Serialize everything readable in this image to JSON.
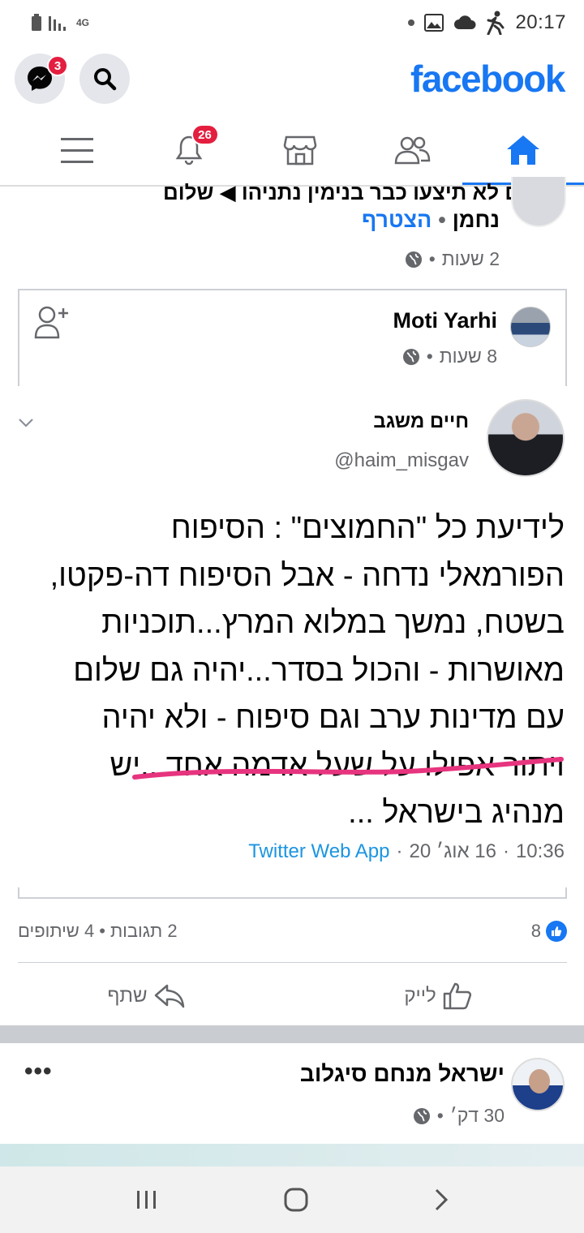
{
  "statusbar": {
    "network": "4G",
    "time": "20:17"
  },
  "header": {
    "logo": "facebook",
    "messenger_badge": "3"
  },
  "nav": {
    "notifications_badge": "26"
  },
  "feed": {
    "prev_post": {
      "cut_text": "לעולם לא תיצעו כבר בנימין נתניהו ◀ שלום",
      "author": "נחמן",
      "join_label": "הצטרף",
      "time": "2 שעות"
    },
    "shared_post": {
      "author": "Moti Yarhi",
      "time": "8 שעות"
    },
    "tweet": {
      "name": "חיים משגב",
      "handle": "@haim_misgav",
      "text_lines": [
        "לידיעת כל \"החמוצים\" : הסיפוח",
        "הפורמאלי נדחה - אבל הסיפוח דה-פקטו,",
        "בשטח, נמשך במלוא המרץ...תוכניות",
        "מאושרות - והכול בסדר...יהיה גם שלום",
        "עם מדינות ערב וגם סיפוח - ולא יהיה",
        "ויתור אפילו על שעל אדמה אחד...יש",
        "מנהיג בישראל ..."
      ],
      "time": "10:36",
      "date": "16 אוג׳ 20",
      "app": "Twitter Web App"
    },
    "reactions": {
      "likes": "8",
      "comments": "2 תגובות",
      "shares": "4 שיתופים"
    },
    "actions": {
      "like": "לייק",
      "share": "שתף"
    },
    "next_post": {
      "author": "ישראל מנחם סיגלוב",
      "time": "30 דק׳"
    }
  }
}
